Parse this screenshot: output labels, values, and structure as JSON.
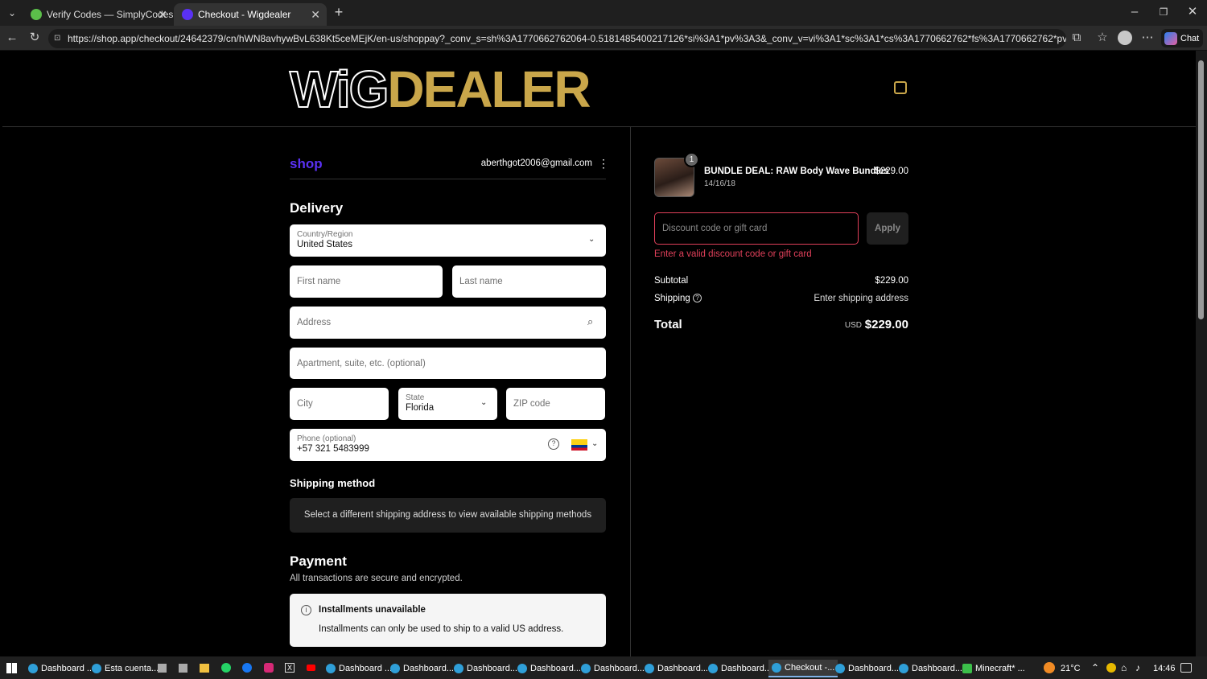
{
  "browser": {
    "tabs": [
      {
        "title": "Verify Codes — SimplyCodes",
        "active": false
      },
      {
        "title": "Checkout - Wigdealer",
        "active": true
      }
    ],
    "url": "https://shop.app/checkout/24642379/cn/hWN8avhywBvL638Kt5ceMEjK/en-us/shoppay?_conv_s=sh%3A1770662762064-0.5181485400217126*si%3A1*pv%3A3&_conv_v=vi%3A1*sc%3A1*cs%3A1770662762*fs%3A1770662762*pv%3A3*exp...",
    "chat_label": "Chat"
  },
  "store": {
    "logo_left": "WiG",
    "logo_right": "DEALER",
    "accent": "#c9a64a"
  },
  "shop_pay": {
    "brand": "shop",
    "email": "aberthgot2006@gmail.com"
  },
  "delivery": {
    "heading": "Delivery",
    "country_label": "Country/Region",
    "country_value": "United States",
    "first_name_placeholder": "First name",
    "last_name_placeholder": "Last name",
    "address_placeholder": "Address",
    "apartment_placeholder": "Apartment, suite, etc. (optional)",
    "city_placeholder": "City",
    "state_label": "State",
    "state_value": "Florida",
    "zip_placeholder": "ZIP code",
    "phone_label": "Phone (optional)",
    "phone_value": "+57 321 5483999"
  },
  "shipping_method": {
    "heading": "Shipping method",
    "notice": "Select a different shipping address to view available shipping methods"
  },
  "payment": {
    "heading": "Payment",
    "subtitle": "All transactions are secure and encrypted.",
    "installments_title": "Installments unavailable",
    "installments_text": "Installments can only be used to ship to a valid US address."
  },
  "order": {
    "item_qty": "1",
    "item_name": "BUNDLE DEAL: RAW Body Wave Bundles",
    "item_variant": "14/16/18",
    "item_price": "$229.00",
    "discount_placeholder": "Discount code or gift card",
    "apply_label": "Apply",
    "discount_error": "Enter a valid discount code or gift card",
    "subtotal_label": "Subtotal",
    "subtotal_value": "$229.00",
    "shipping_label": "Shipping",
    "shipping_value": "Enter shipping address",
    "total_label": "Total",
    "currency": "USD",
    "total_value": "$229.00"
  },
  "taskbar": {
    "items": [
      "Dashboard ...",
      "Esta cuenta...",
      "Dashboard ...",
      "Dashboard...",
      "Dashboard...",
      "Dashboard...",
      "Dashboard...",
      "Dashboard...",
      "Dashboard...",
      "Checkout -...",
      "Dashboard...",
      "Dashboard...",
      "Minecraft* ..."
    ],
    "temperature": "21°C",
    "time": "14:46"
  }
}
